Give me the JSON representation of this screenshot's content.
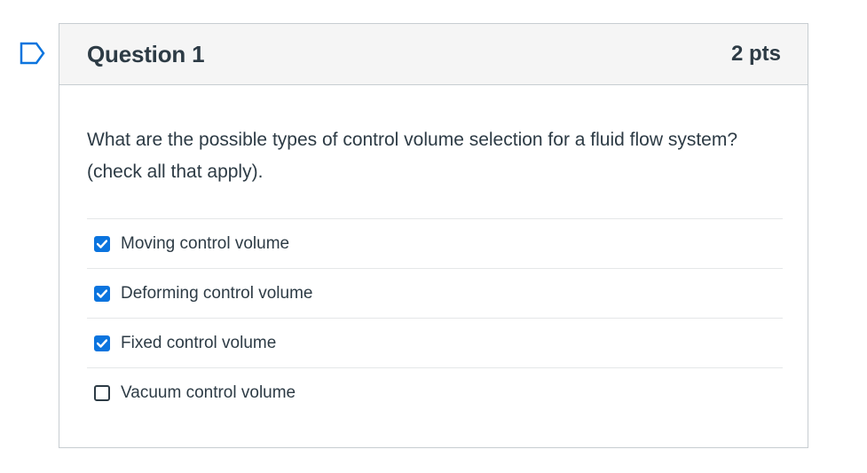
{
  "question": {
    "title": "Question 1",
    "points": "2 pts",
    "text": "What are the possible types of control volume selection for a fluid flow system? (check all that apply).",
    "flag_icon": "flag-outline-icon",
    "answers": [
      {
        "label": "Moving control volume",
        "checked": true
      },
      {
        "label": "Deforming control volume",
        "checked": true
      },
      {
        "label": "Fixed control volume",
        "checked": true
      },
      {
        "label": "Vacuum control volume",
        "checked": false
      }
    ]
  },
  "colors": {
    "accent": "#0b74de",
    "text": "#2d3b45",
    "header_bg": "#f5f5f5",
    "border": "#c7cdd1"
  }
}
